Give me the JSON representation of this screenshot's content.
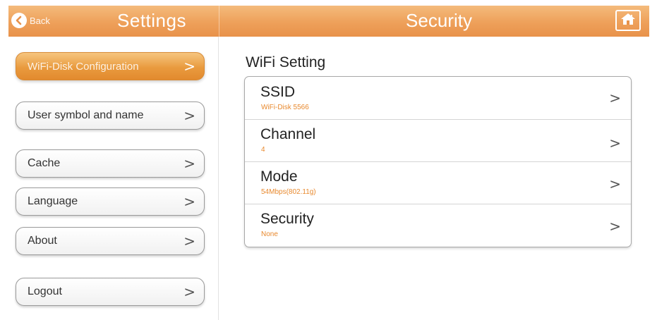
{
  "header": {
    "back_label": "Back",
    "left_title": "Settings",
    "right_title": "Security"
  },
  "sidebar": {
    "items": [
      {
        "label": "WiFi-Disk Configuration",
        "active": true
      },
      {
        "label": "User symbol and name",
        "active": false
      },
      {
        "label": "Cache",
        "active": false
      },
      {
        "label": "Language",
        "active": false
      },
      {
        "label": "About",
        "active": false
      },
      {
        "label": "Logout",
        "active": false
      }
    ],
    "chevron": ">"
  },
  "main": {
    "section_title": "WiFi Setting",
    "settings": [
      {
        "name": "SSID",
        "value": "WiFi-Disk 5566"
      },
      {
        "name": "Channel",
        "value": "4"
      },
      {
        "name": "Mode",
        "value": "54Mbps(802.11g)"
      },
      {
        "name": "Security",
        "value": "None"
      }
    ]
  },
  "colors": {
    "accent": "#e99b3f",
    "value_text": "#e8892e"
  },
  "icons": {
    "back": "back-arrow-icon",
    "home": "home-icon",
    "chevron": "chevron-right-icon"
  }
}
